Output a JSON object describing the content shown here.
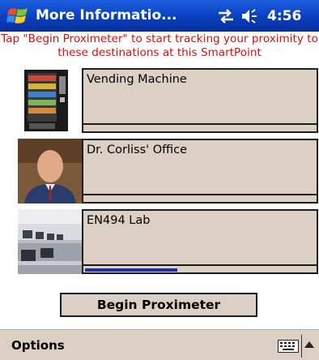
{
  "titlebar": {
    "title": "More Informatio...",
    "time": "4:56",
    "start_icon": "windows-start-icon",
    "connectivity_icon": "connectivity-icon",
    "volume_icon": "speaker-icon"
  },
  "instructions": "Tap \"Begin Proximeter\" to start tracking your proximity to these destinations at this SmartPoint",
  "destinations": [
    {
      "name": "Vending Machine",
      "thumbnail": "vending-machine-photo",
      "proximity": 0.0
    },
    {
      "name": "Dr. Corliss' Office",
      "thumbnail": "person-portrait-photo",
      "proximity": 0.0
    },
    {
      "name": "EN494 Lab",
      "thumbnail": "computer-lab-photo",
      "proximity": 0.4
    }
  ],
  "begin_button": "Begin Proximeter",
  "menubar": {
    "options_label": "Options",
    "keyboard_icon": "keyboard-icon",
    "input_arrow_icon": "up-arrow-icon"
  },
  "colors": {
    "titlebar": "#0a3fbf",
    "instructions": "#d21010",
    "panel": "#dccfc3",
    "meter_fill": "#1c2fa8"
  }
}
